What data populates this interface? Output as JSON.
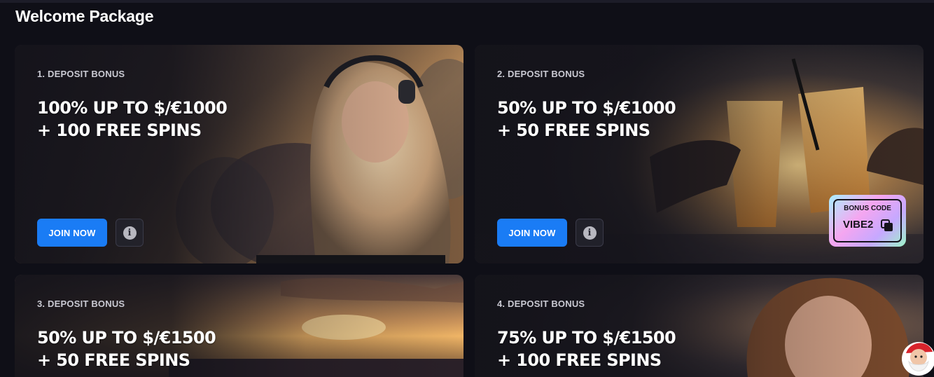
{
  "page": {
    "title": "Welcome Package"
  },
  "cards": [
    {
      "label": "1. DEPOSIT BONUS",
      "headline_line1": "100% UP TO $/€1000",
      "headline_line2": "+ 100 FREE SPINS",
      "join_label": "JOIN NOW",
      "info_icon": "i"
    },
    {
      "label": "2. DEPOSIT BONUS",
      "headline_line1": "50% UP TO $/€1000",
      "headline_line2": "+ 50 FREE SPINS",
      "join_label": "JOIN NOW",
      "info_icon": "i",
      "bonus_code": {
        "label": "BONUS CODE",
        "value": "VIBE2"
      }
    },
    {
      "label": "3. DEPOSIT BONUS",
      "headline_line1": "50% UP TO $/€1500",
      "headline_line2": "+ 50 FREE SPINS"
    },
    {
      "label": "4. DEPOSIT BONUS",
      "headline_line1": "75% UP TO $/€1500",
      "headline_line2": "+ 100 FREE SPINS"
    }
  ],
  "colors": {
    "background": "#0f0f17",
    "card": "#1b1a22",
    "primary_button": "#1a7cf5",
    "label_text": "#c9c9d2"
  },
  "icons": {
    "info": "info-icon",
    "copy": "copy-icon",
    "chat": "santa-chat-icon"
  }
}
